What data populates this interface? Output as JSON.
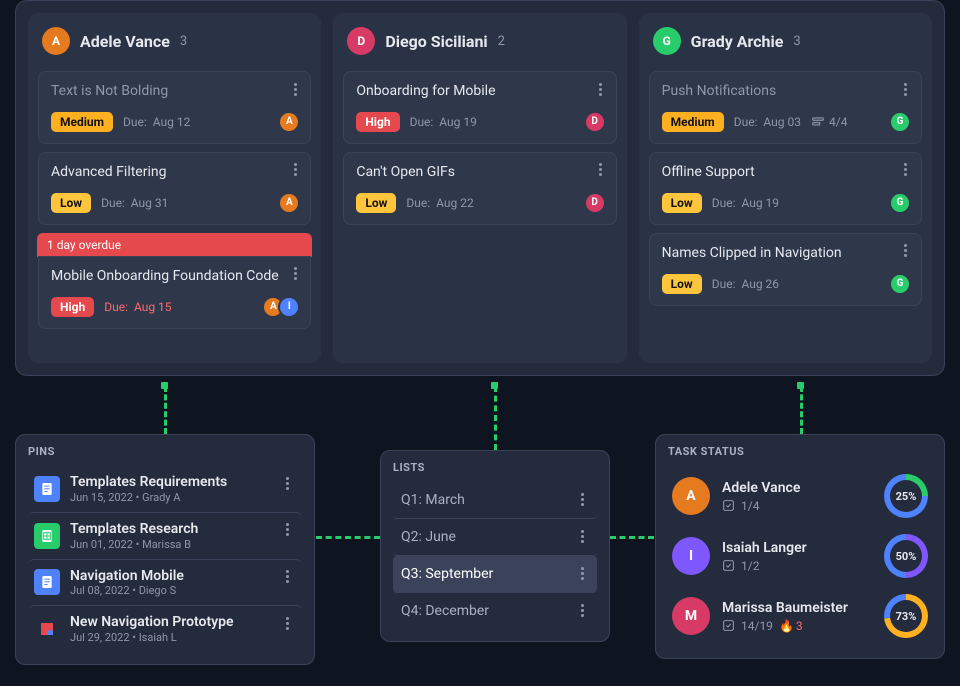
{
  "columns": [
    {
      "avatar_bg": "#e57b1e",
      "avatar_initial": "A",
      "name": "Adele Vance",
      "count": 3,
      "cards": [
        {
          "title": "Text is Not Bolding",
          "faded": true,
          "priority": "Medium",
          "priority_class": "medium",
          "due_label": "Due:",
          "due_date": "Aug 12",
          "assignees": [
            {
              "bg": "#e57b1e",
              "initial": "A"
            }
          ]
        },
        {
          "title": "Advanced Filtering",
          "priority": "Low",
          "priority_class": "low",
          "due_label": "Due:",
          "due_date": "Aug 31",
          "assignees": [
            {
              "bg": "#e57b1e",
              "initial": "A"
            }
          ]
        },
        {
          "overdue": "1 day overdue",
          "title": "Mobile Onboarding Foundation Code",
          "priority": "High",
          "priority_class": "high",
          "due_label": "Due:",
          "due_date": "Aug 15",
          "due_red": true,
          "assignees": [
            {
              "bg": "#e57b1e",
              "initial": "A"
            },
            {
              "bg": "#4f82ff",
              "initial": "I"
            }
          ]
        }
      ]
    },
    {
      "avatar_bg": "#d83a66",
      "avatar_initial": "D",
      "name": "Diego Siciliani",
      "count": 2,
      "cards": [
        {
          "title": "Onboarding for Mobile",
          "priority": "High",
          "priority_class": "high",
          "due_label": "Due:",
          "due_date": "Aug 19",
          "assignees": [
            {
              "bg": "#d83a66",
              "initial": "D"
            }
          ]
        },
        {
          "title": "Can't Open GIFs",
          "priority": "Low",
          "priority_class": "low",
          "due_label": "Due:",
          "due_date": "Aug 22",
          "assignees": [
            {
              "bg": "#d83a66",
              "initial": "D"
            }
          ]
        }
      ]
    },
    {
      "avatar_bg": "#29cc6a",
      "avatar_initial": "G",
      "name": "Grady Archie",
      "count": 3,
      "cards": [
        {
          "title": "Push Notifications",
          "faded": true,
          "priority": "Medium",
          "priority_class": "medium",
          "due_label": "Due:",
          "due_date": "Aug 03",
          "subtask": "4/4",
          "assignees": [
            {
              "bg": "#29cc6a",
              "initial": "G"
            }
          ]
        },
        {
          "title": "Offline Support",
          "priority": "Low",
          "priority_class": "low",
          "due_label": "Due:",
          "due_date": "Aug 19",
          "assignees": [
            {
              "bg": "#29cc6a",
              "initial": "G"
            }
          ]
        },
        {
          "title": "Names Clipped in Navigation",
          "priority": "Low",
          "priority_class": "low",
          "due_label": "Due:",
          "due_date": "Aug 26",
          "assignees": [
            {
              "bg": "#29cc6a",
              "initial": "G"
            }
          ]
        }
      ]
    }
  ],
  "pins": {
    "title": "PINS",
    "items": [
      {
        "icon_bg": "#4f82ff",
        "icon_kind": "doc",
        "title": "Templates Requirements",
        "sub": "Jun 15, 2022 • Grady A"
      },
      {
        "icon_bg": "#29cc6a",
        "icon_kind": "sheet",
        "title": "Templates Research",
        "sub": "Jun 01, 2022 • Marissa B"
      },
      {
        "icon_bg": "#4f82ff",
        "icon_kind": "doc",
        "title": "Navigation Mobile",
        "sub": "Jul 08, 2022 • Diego S"
      },
      {
        "icon_bg": "#ffffff",
        "icon_kind": "proto",
        "title": "New Navigation Prototype",
        "sub": "Jul 29, 2022 • Isaiah L"
      }
    ]
  },
  "lists": {
    "title": "LISTS",
    "items": [
      {
        "label": "Q1: March"
      },
      {
        "label": "Q2: June"
      },
      {
        "label": "Q3: September",
        "selected": true
      },
      {
        "label": "Q4: December"
      }
    ]
  },
  "status": {
    "title": "TASK STATUS",
    "items": [
      {
        "avatar_bg": "#e57b1e",
        "avatar_initial": "A",
        "name": "Adele Vance",
        "check": "1/4",
        "pct": "25%",
        "pval": 25,
        "ring1": "#29cc6a",
        "ring2": "#4f82ff"
      },
      {
        "avatar_bg": "#7e57ff",
        "avatar_initial": "I",
        "name": "Isaiah Langer",
        "check": "1/2",
        "pct": "50%",
        "pval": 50,
        "ring1": "#7e57ff",
        "ring2": "#4f82ff"
      },
      {
        "avatar_bg": "#d83a66",
        "avatar_initial": "M",
        "name": "Marissa Baumeister",
        "check": "14/19",
        "flame": "3",
        "pct": "73%",
        "pval": 73,
        "ring1": "#ffb020",
        "ring2": "#4f82ff"
      }
    ]
  }
}
